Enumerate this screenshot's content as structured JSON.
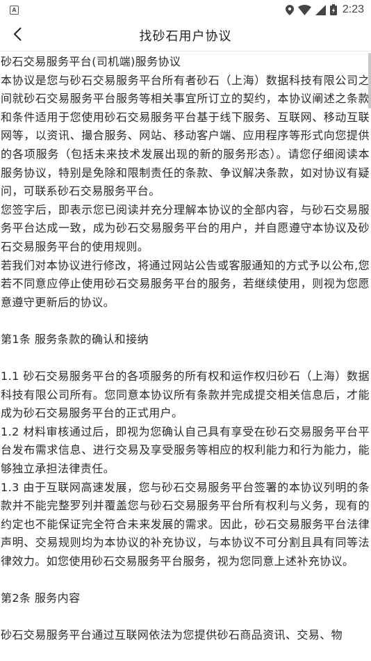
{
  "status_bar": {
    "time": "2:23",
    "icons": [
      "a-icon",
      "location-icon",
      "wifi-icon",
      "signal-icon",
      "battery-icon"
    ]
  },
  "app_bar": {
    "title": "找砂石用户协议",
    "back_icon": "back-arrow-icon"
  },
  "document": {
    "heading": "砂石交易服务平台(司机端)服务协议",
    "intro": "本协议是您与砂石交易服务平台所有者砂石（上海）数据科技有限公司之间就砂石交易服务平台服务等相关事宜所订立的契约，本协议阐述之条款和条件适用于您使用砂石交易服务平台基于线下服务、互联网、移动互联网等，以资讯、撮合服务、网站、移动客户端、应用程序等形式向您提供的各项服务（包括未来技术发展出现的新的服务形态）。请您仔细阅读本服务协议，特别是免除和限制责任的条款、争议解决条款，如对协议有疑问，可联系砂石交易服务平台。",
    "consent": "您签字后，即表示您已阅读并充分理解本协议的全部内容，与砂石交易服务平台达成一致，成为砂石交易服务平台的用户，并自愿遵守本协议及砂石交易服务平台的使用规则。",
    "modification": "若我们对本协议进行修改，将通过网站公告或客服通知的方式予以公布,您若不同意应停止使用砂石交易服务平台的服务，若继续使用，则视为您愿意遵守更新后的协议。",
    "section1_title": "第1条 服务条款的确认和接纳",
    "clause_1_1": "1.1 砂石交易服务平台的各项服务的所有权和运作权归砂石（上海）数据科技有限公司所有。您同意本协议所有条款并完成提交相关信息后，才能成为砂石交易服务平台的正式用户。",
    "clause_1_2": "1.2 材料审核通过后，即视为您确认自己具有享受在砂石交易服务平台平台发布需求信息、进行交易及享受服务等相应的权利能力和行为能力，能够独立承担法律责任。",
    "clause_1_3": "1.3 由于互联网高速发展，您与砂石交易服务平台签署的本协议列明的条款并不能完整罗列并覆盖您与砂石交易服务平台所有权利与义务，现有的约定也不能保证完全符合未来发展的需求。因此，砂石交易服务平台法律声明、交易规则均为本协议的补充协议，与本协议不可分割且具有同等法律效力。如您使用砂石交易服务平台服务，视为您同意上述补充协议。",
    "section2_title": "第2条 服务内容",
    "section2_body": "砂石交易服务平台通过互联网依法为您提供砂石商品资讯、交易、物"
  },
  "colors": {
    "background": "#ffffff",
    "text": "#2a2a2a",
    "divider": "#e6e6e6"
  }
}
